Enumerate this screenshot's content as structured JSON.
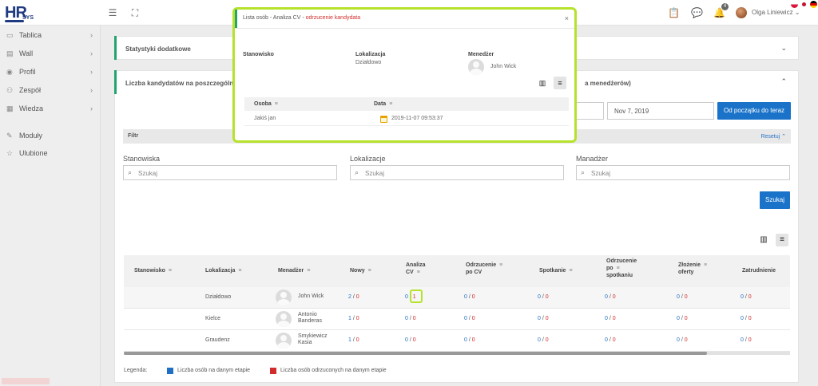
{
  "topbar": {
    "logo_main": "HR",
    "logo_sub": "SYS",
    "notification_count": "4",
    "user_name": "Olga Liniewicz"
  },
  "sidebar": {
    "items": [
      {
        "label": "Tablica",
        "icon": "monitor-icon"
      },
      {
        "label": "Wall",
        "icon": "wall-icon"
      },
      {
        "label": "Profil",
        "icon": "profile-icon"
      },
      {
        "label": "Zespół",
        "icon": "team-icon"
      },
      {
        "label": "Wiedza",
        "icon": "book-icon"
      },
      {
        "label": "Moduły",
        "icon": "wrench-icon"
      },
      {
        "label": "Ulubione",
        "icon": "star-icon"
      }
    ]
  },
  "panels": {
    "stats_title": "Statystyki dodatkowe",
    "candidates_title_start": "Liczba kandydatów na poszczególnych",
    "candidates_title_end": "a menedżerów)"
  },
  "dates": {
    "to_date": "Nov 7, 2019",
    "from_start_button": "Od początku do teraz"
  },
  "filter": {
    "title": "Filtr",
    "reset": "Resetuj",
    "stanowiska_label": "Stanowiska",
    "lokalizacje_label": "Lokalizacje",
    "menadzer_label": "Manadżer",
    "search_placeholder": "Szukaj",
    "search_button": "Szukaj"
  },
  "table": {
    "headers": {
      "stanowisko": "Stanowisko",
      "lokalizacja": "Lokalizacja",
      "menadzer": "Menadżer",
      "nowy": "Nowy",
      "analiza_1": "Analiza",
      "analiza_2": "CV",
      "odrzucenie_cv_1": "Odrzucenie",
      "odrzucenie_cv_2": "po CV",
      "spotkanie": "Spotkanie",
      "odrz_spot_1": "Odrzucenie",
      "odrz_spot_2": "po",
      "odrz_spot_3": "spotkaniu",
      "zlozenie_1": "Złożenie",
      "zlozenie_2": "oferty",
      "zatrudnienie": "Zatrudnienie"
    },
    "rows": [
      {
        "lokalizacja": "Działdowo",
        "menadzer_1": "John Wick",
        "menadzer_2": "",
        "nowy": [
          "2",
          "0"
        ],
        "analiza": [
          "0",
          "1"
        ],
        "odrz_cv": [
          "0",
          "0"
        ],
        "spotkanie": [
          "0",
          "0"
        ],
        "odrz_spot": [
          "0",
          "0"
        ],
        "zlozenie": [
          "0",
          "0"
        ],
        "zatrudnienie": [
          "0",
          "0"
        ]
      },
      {
        "lokalizacja": "Kielce",
        "menadzer_1": "Antonio",
        "menadzer_2": "Banderas",
        "nowy": [
          "1",
          "0"
        ],
        "analiza": [
          "0",
          "0"
        ],
        "odrz_cv": [
          "0",
          "0"
        ],
        "spotkanie": [
          "0",
          "0"
        ],
        "odrz_spot": [
          "0",
          "0"
        ],
        "zlozenie": [
          "0",
          "0"
        ],
        "zatrudnienie": [
          "0",
          "0"
        ]
      },
      {
        "lokalizacja": "Graudenz",
        "menadzer_1": "Smykiewicz",
        "menadzer_2": "Kasia",
        "nowy": [
          "1",
          "0"
        ],
        "analiza": [
          "0",
          "0"
        ],
        "odrz_cv": [
          "0",
          "0"
        ],
        "spotkanie": [
          "0",
          "0"
        ],
        "odrz_spot": [
          "0",
          "0"
        ],
        "zlozenie": [
          "0",
          "0"
        ],
        "zatrudnienie": [
          "0",
          "0"
        ]
      }
    ],
    "separator": " / "
  },
  "legend": {
    "label": "Legenda:",
    "blue_text": "Liczba osób na danym etapie",
    "red_text": "Liczba osób odrzuconych na danym etapie",
    "blue_color": "#1f6fc5",
    "red_color": "#d22b2b"
  },
  "modal": {
    "title_prefix": "Lista osób - Analiza CV - ",
    "title_highlight": "odrzucenie kandydata",
    "stanowisko_label": "Stanowisko",
    "lokalizacja_label": "Lokalizacja",
    "lokalizacja_value": "Działdowo",
    "menedzer_label": "Menedżer",
    "menedzer_value": "John Wick",
    "col_osoba": "Osoba",
    "col_data": "Data",
    "row_osoba": "Jakiś jan",
    "row_data": "2019-11-07 09:53:37"
  },
  "colors": {
    "accent_green": "#25a36f",
    "highlight_lime": "#b6e22b",
    "primary_blue": "#1a73c9"
  }
}
